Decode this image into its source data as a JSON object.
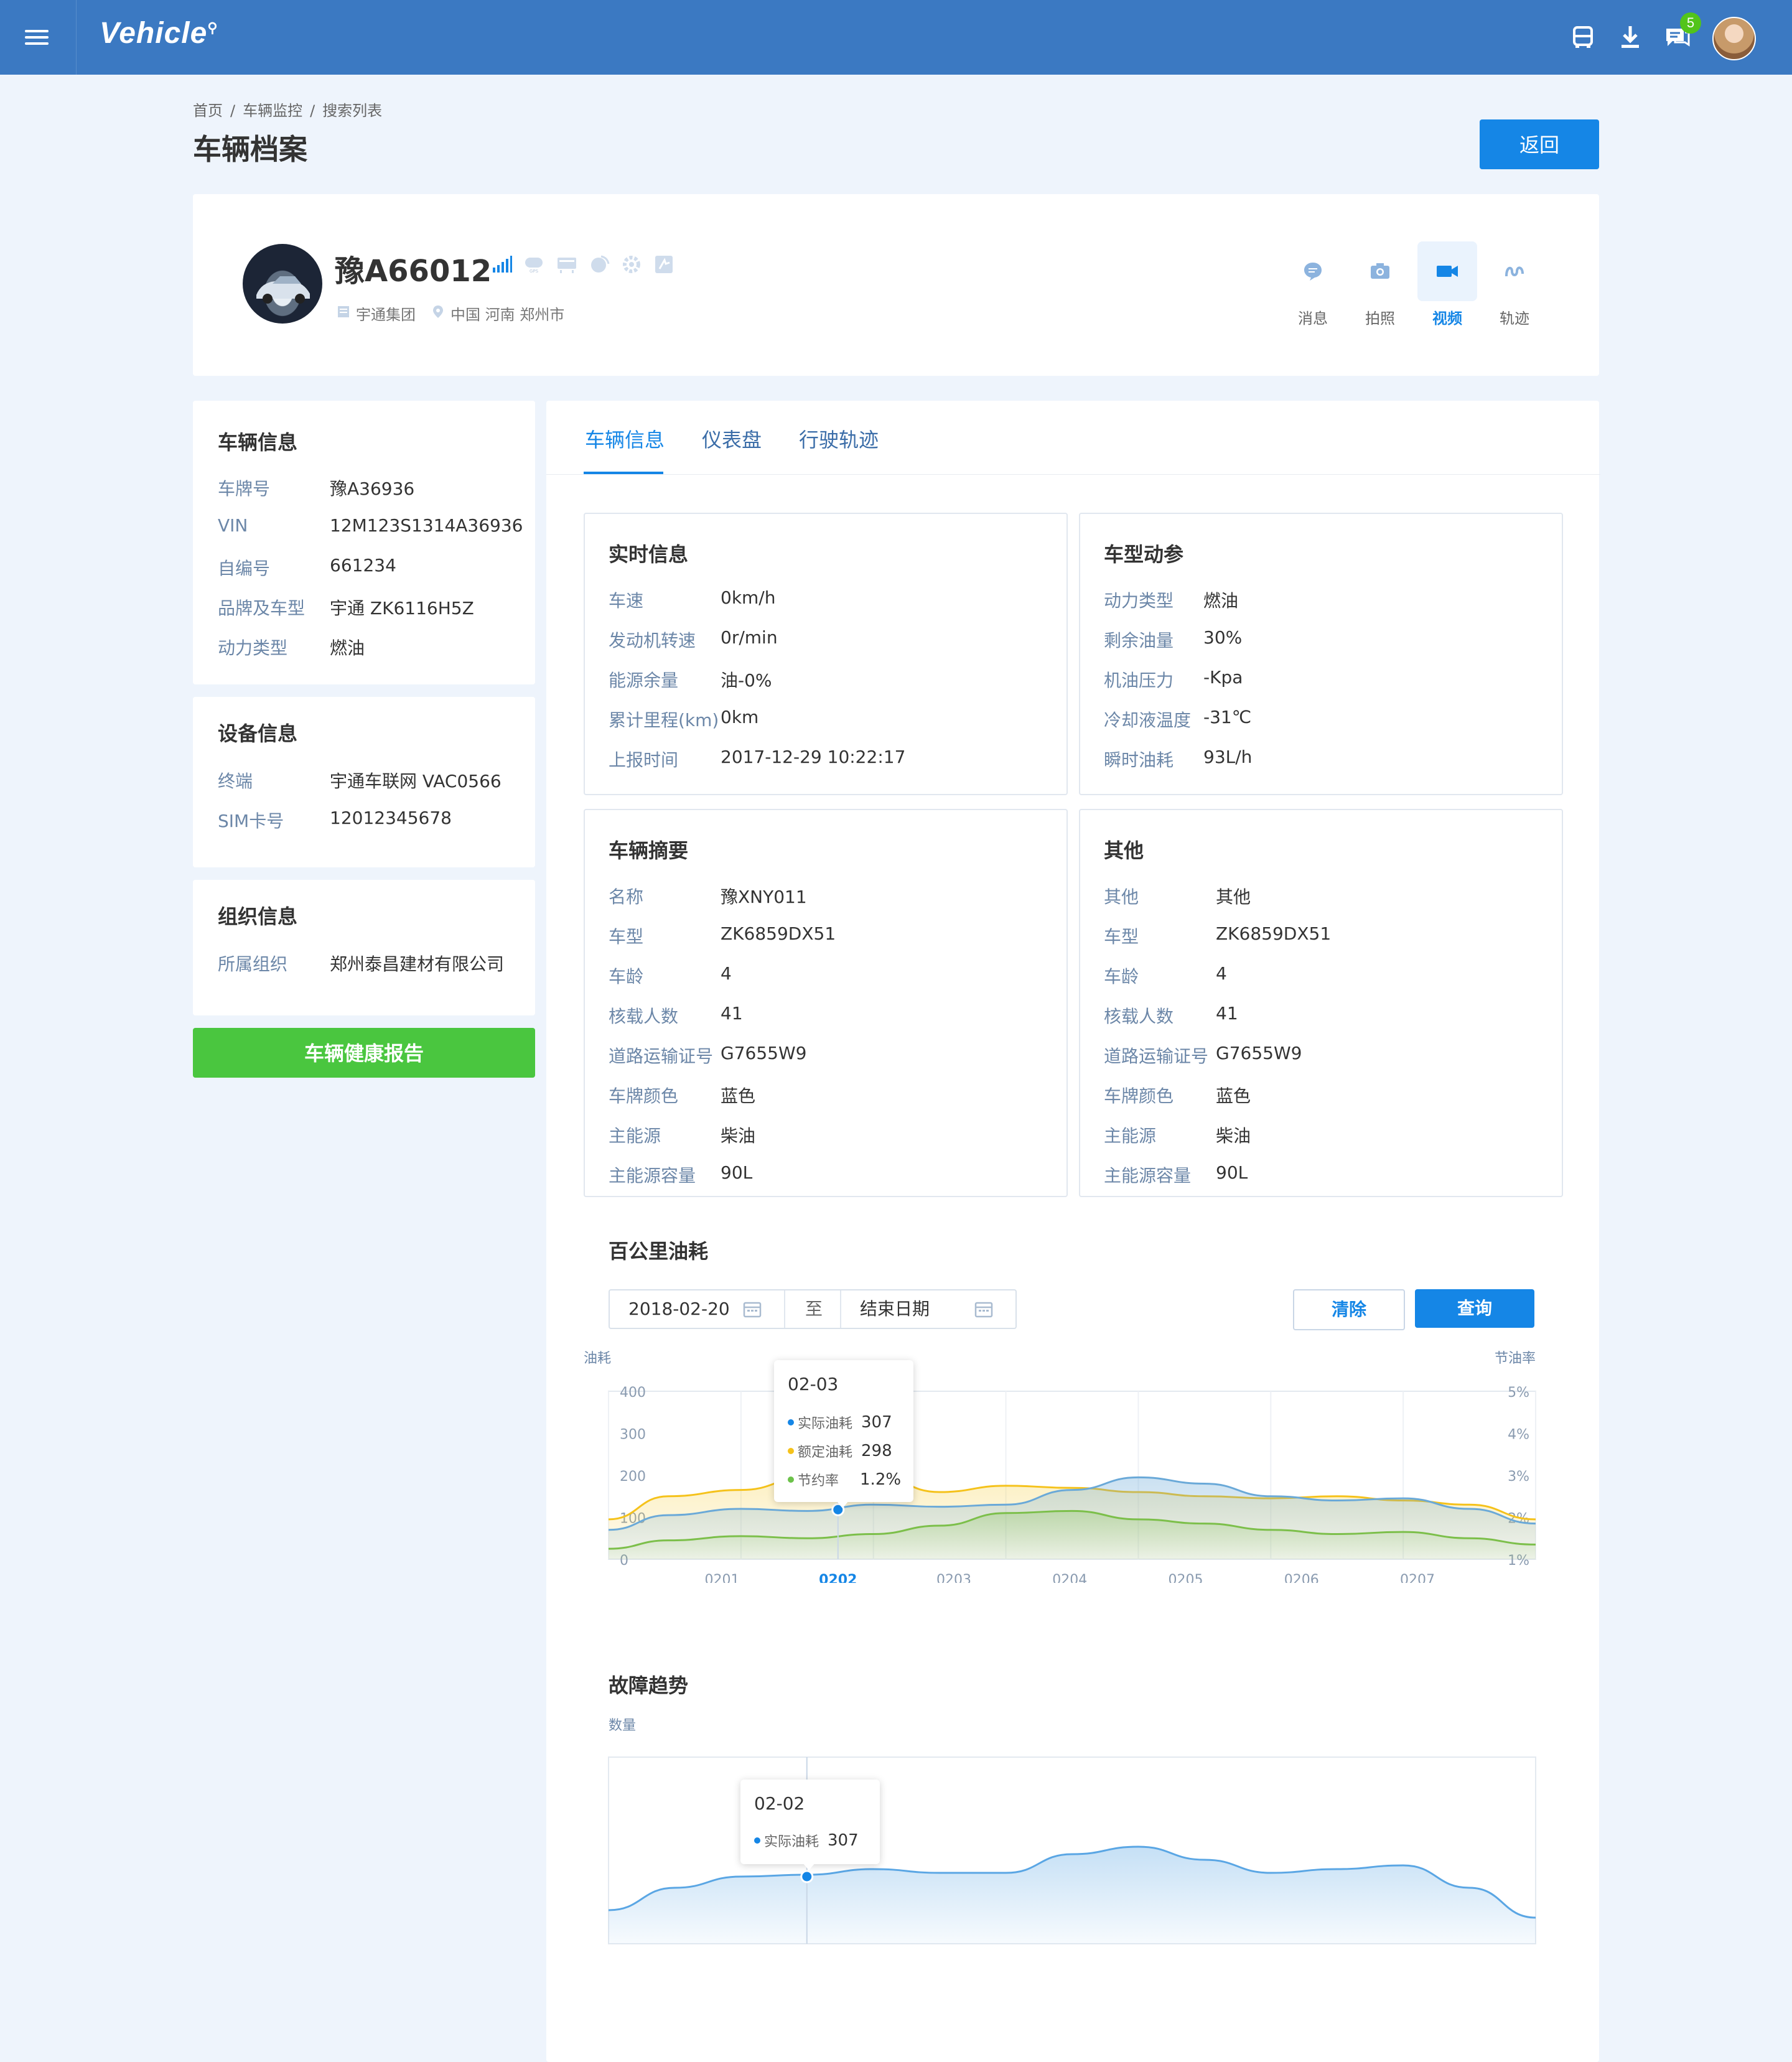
{
  "app": {
    "logo": "Vehicle",
    "notification_count": "5"
  },
  "breadcrumb": [
    "首页",
    "/",
    "车辆监控",
    "/",
    "搜索列表"
  ],
  "page_title": "车辆档案",
  "back_label": "返回",
  "vehicle": {
    "plate": "豫A66012",
    "company": "宇通集团",
    "location": "中国 河南 郑州市",
    "actions": [
      "消息",
      "拍照",
      "视频",
      "轨迹"
    ]
  },
  "left": {
    "vehicle_info": {
      "title": "车辆信息",
      "rows": [
        {
          "k": "车牌号",
          "v": "豫A36936"
        },
        {
          "k": "VIN",
          "v": "12M123S1314A36936"
        },
        {
          "k": "自编号",
          "v": "661234"
        },
        {
          "k": "品牌及车型",
          "v": "宇通 ZK6116H5Z"
        },
        {
          "k": "动力类型",
          "v": "燃油"
        }
      ]
    },
    "device_info": {
      "title": "设备信息",
      "rows": [
        {
          "k": "终端",
          "v": "宇通车联网 VAC0566"
        },
        {
          "k": "SIM卡号",
          "v": "12012345678"
        }
      ]
    },
    "org_info": {
      "title": "组织信息",
      "rows": [
        {
          "k": "所属组织",
          "v": "郑州泰昌建材有限公司"
        }
      ]
    },
    "health_btn": "车辆健康报告"
  },
  "tabs": [
    "车辆信息",
    "仪表盘",
    "行驶轨迹"
  ],
  "realtime": {
    "title": "实时信息",
    "rows": [
      {
        "k": "车速",
        "v": "0km/h"
      },
      {
        "k": "发动机转速",
        "v": "0r/min"
      },
      {
        "k": "能源余量",
        "v": "油-0%"
      },
      {
        "k": "累计里程(km)",
        "v": "0km"
      },
      {
        "k": "上报时间",
        "v": "2017-12-29 10:22:17"
      }
    ]
  },
  "dynamics": {
    "title": "车型动参",
    "rows": [
      {
        "k": "动力类型",
        "v": "燃油"
      },
      {
        "k": "剩余油量",
        "v": "30%"
      },
      {
        "k": "机油压力",
        "v": "-Kpa"
      },
      {
        "k": "冷却液温度",
        "v": "-31℃"
      },
      {
        "k": "瞬时油耗",
        "v": "93L/h"
      }
    ]
  },
  "summary": {
    "title": "车辆摘要",
    "rows": [
      {
        "k": "名称",
        "v": "豫XNY011"
      },
      {
        "k": "车型",
        "v": "ZK6859DX51"
      },
      {
        "k": "车龄",
        "v": "4"
      },
      {
        "k": "核载人数",
        "v": "41"
      },
      {
        "k": "道路运输证号",
        "v": "G7655W9"
      },
      {
        "k": "车牌颜色",
        "v": "蓝色"
      },
      {
        "k": "主能源",
        "v": "柴油"
      },
      {
        "k": "主能源容量",
        "v": "90L"
      }
    ]
  },
  "other": {
    "title": "其他",
    "rows": [
      {
        "k": "其他",
        "v": "其他"
      },
      {
        "k": "车型",
        "v": "ZK6859DX51"
      },
      {
        "k": "车龄",
        "v": "4"
      },
      {
        "k": "核载人数",
        "v": "41"
      },
      {
        "k": "道路运输证号",
        "v": "G7655W9"
      },
      {
        "k": "车牌颜色",
        "v": "蓝色"
      },
      {
        "k": "主能源",
        "v": "柴油"
      },
      {
        "k": "主能源容量",
        "v": "90L"
      }
    ]
  },
  "fuel_section": {
    "title": "百公里油耗",
    "start_date": "2018-02-20",
    "to": "至",
    "end_placeholder": "结束日期",
    "clear": "清除",
    "query": "查询",
    "tooltip": {
      "date": "02-03",
      "items": [
        {
          "label": "实际油耗",
          "value": "307",
          "color": "#1586e6"
        },
        {
          "label": "额定油耗",
          "value": "298",
          "color": "#f5c21b"
        },
        {
          "label": "节约率",
          "value": "1.2%",
          "color": "#6cc24a"
        }
      ]
    }
  },
  "fault_section": {
    "title": "故障趋势",
    "tooltip": {
      "date": "02-02",
      "label": "实际油耗",
      "value": "307"
    }
  },
  "chart_data": [
    {
      "type": "area",
      "ylabel": "油耗",
      "y2label": "节油率",
      "categories": [
        "0201",
        "0202",
        "0203",
        "0204",
        "0205",
        "0206",
        "0207"
      ],
      "highlight": "0202",
      "ylim": [
        0,
        400
      ],
      "yticks": [
        0,
        100,
        200,
        300,
        400
      ],
      "y2ticks": [
        "1%",
        "2%",
        "3%",
        "4%",
        "5%"
      ],
      "series": [
        {
          "name": "额定油耗",
          "color": "#f5c21b",
          "x": [
            0,
            0.45,
            1,
            1.5,
            2,
            2.5,
            3,
            3.5,
            4,
            4.5,
            5,
            5.5,
            6,
            6.5,
            7
          ],
          "values": [
            95,
            150,
            165,
            195,
            200,
            160,
            175,
            170,
            160,
            150,
            145,
            150,
            140,
            130,
            95
          ]
        },
        {
          "name": "实际油耗",
          "color": "#6aa9d8",
          "x": [
            0,
            0.45,
            1,
            1.5,
            2,
            2.5,
            3,
            3.5,
            4,
            4.5,
            5,
            5.5,
            6,
            6.5,
            7
          ],
          "values": [
            70,
            105,
            120,
            115,
            130,
            125,
            130,
            165,
            195,
            180,
            150,
            140,
            145,
            120,
            85
          ]
        },
        {
          "name": "节约率",
          "color": "#7cbf4a",
          "x": [
            0,
            0.45,
            1,
            1.5,
            2,
            2.5,
            3,
            3.5,
            4,
            4.5,
            5,
            5.5,
            6,
            6.5,
            7
          ],
          "values": [
            25,
            45,
            55,
            50,
            60,
            80,
            110,
            115,
            95,
            85,
            70,
            60,
            65,
            50,
            35
          ]
        }
      ]
    },
    {
      "type": "area",
      "ylabel": "数量",
      "categories": [
        "0201",
        "0202",
        "0203",
        "0204",
        "0205",
        "0206",
        "0207"
      ],
      "highlight": "0202",
      "series": [
        {
          "name": "实际油耗",
          "color": "#5aa6e4",
          "x": [
            0,
            0.5,
            1,
            1.5,
            2,
            2.5,
            3,
            3.5,
            4,
            4.5,
            5,
            5.5,
            6,
            6.5,
            7
          ],
          "values": [
            18,
            30,
            36,
            37,
            40,
            38,
            38,
            48,
            52,
            45,
            38,
            40,
            42,
            30,
            14
          ]
        }
      ]
    }
  ]
}
